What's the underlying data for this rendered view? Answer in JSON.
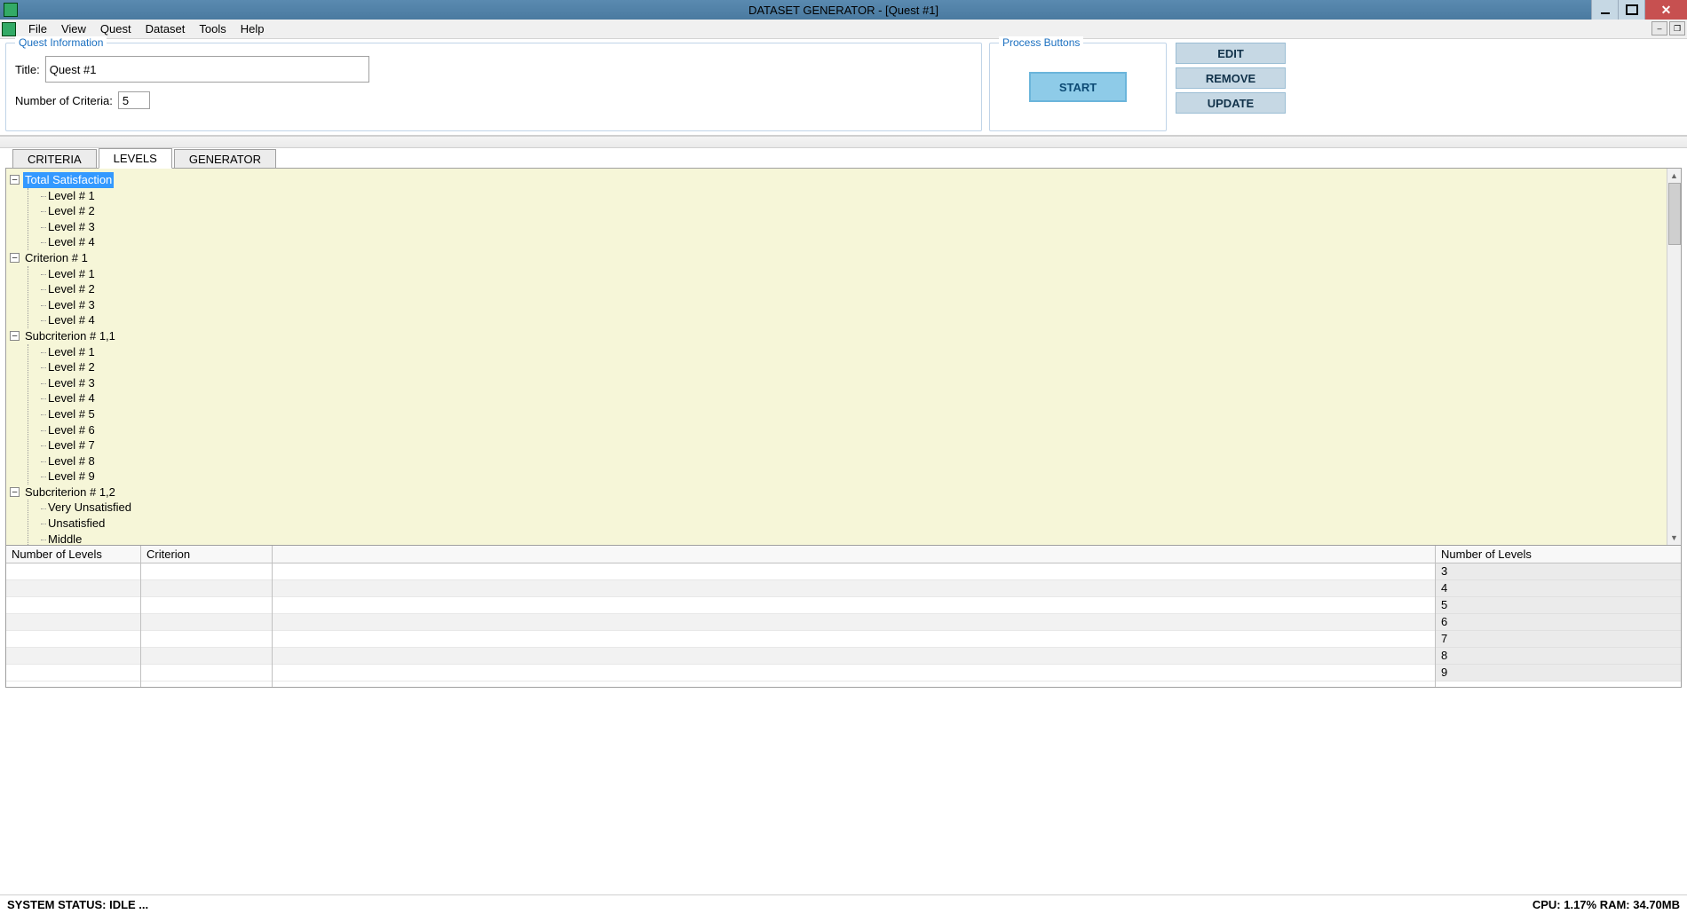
{
  "window": {
    "title": "DATASET GENERATOR - [Quest #1]"
  },
  "menu": {
    "file": "File",
    "view": "View",
    "quest": "Quest",
    "dataset": "Dataset",
    "tools": "Tools",
    "help": "Help"
  },
  "quest_info": {
    "group_label": "Quest Information",
    "title_label": "Title:",
    "title_value": "Quest #1",
    "criteria_label": "Number of Criteria:",
    "criteria_value": "5"
  },
  "process": {
    "group_label": "Process Buttons",
    "start": "START"
  },
  "side": {
    "edit": "EDIT",
    "remove": "REMOVE",
    "update": "UPDATE"
  },
  "tabs": {
    "criteria": "CRITERIA",
    "levels": "LEVELS",
    "generator": "GENERATOR"
  },
  "tree": {
    "n0": {
      "label": "Total Satisfaction",
      "children": [
        "Level # 1",
        "Level # 2",
        "Level # 3",
        "Level # 4"
      ]
    },
    "n1": {
      "label": "Criterion # 1",
      "children": [
        "Level # 1",
        "Level # 2",
        "Level # 3",
        "Level # 4"
      ]
    },
    "n2": {
      "label": "Subcriterion # 1,1",
      "children": [
        "Level # 1",
        "Level # 2",
        "Level # 3",
        "Level # 4",
        "Level # 5",
        "Level # 6",
        "Level # 7",
        "Level # 8",
        "Level # 9"
      ]
    },
    "n3": {
      "label": "Subcriterion # 1,2",
      "children": [
        "Very Unsatisfied",
        "Unsatisfied",
        "Middle"
      ]
    }
  },
  "grid": {
    "col_a": "Number of Levels",
    "col_b": "Criterion",
    "col_d": "Number of Levels",
    "right_values": [
      "3",
      "4",
      "5",
      "6",
      "7",
      "8",
      "9"
    ]
  },
  "status": {
    "left": "SYSTEM STATUS: IDLE ...",
    "right": "CPU: 1.17% RAM: 34.70MB"
  }
}
